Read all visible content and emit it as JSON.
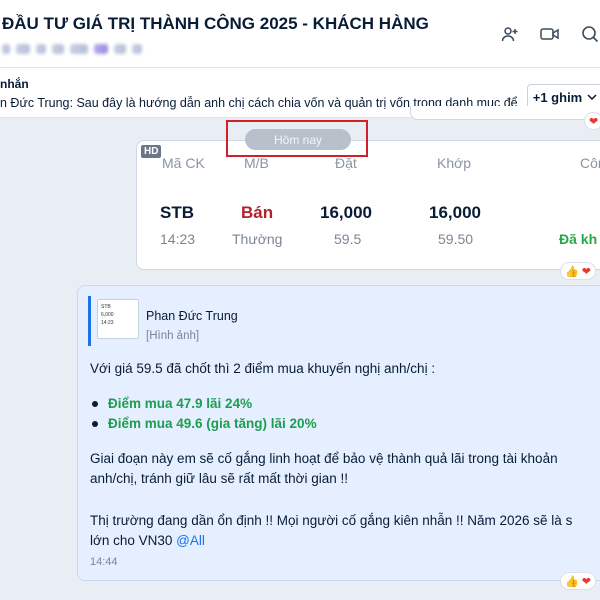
{
  "header": {
    "title": "ĐẦU TƯ GIÁ TRỊ THÀNH CÔNG 2025 - KHÁCH HÀNG",
    "icons": [
      "add-member-icon",
      "video-call-icon",
      "search-icon"
    ]
  },
  "pinned": {
    "label": "nhắn",
    "text": "n Đức Trung: Sau đây là hướng dẫn anh chị cách chia vốn và quản trị vốn trong danh mục để ...",
    "pin_count_label": "+1 ghim"
  },
  "date_divider": {
    "label": "Hôm nay"
  },
  "order_card": {
    "badge": "HD",
    "headers": {
      "symbol": "Mã CK",
      "side": "M/B",
      "ordered": "Đặt",
      "matched": "Khớp",
      "status": "Công"
    },
    "row": {
      "symbol": "STB",
      "time": "14:23",
      "side": "Bán",
      "order_type": "Thường",
      "ordered_qty": "16,000",
      "ordered_price": "59.5",
      "matched_qty": "16,000",
      "matched_price": "59.50",
      "status": "Đã kh"
    }
  },
  "message": {
    "quote": {
      "sender": "Phan Đức Trung",
      "attachment_label": "[Hình ảnh]",
      "thumb_text": [
        "STB",
        "6,000",
        "14:23"
      ]
    },
    "line1": "Với giá 59.5 đã chốt thì 2 điểm mua khuyến nghị anh/chị :",
    "bullets": [
      "Điểm mua 47.9 lãi 24%",
      "Điểm mua 49.6 (gia tăng) lãi 20%"
    ],
    "para2_line1": "Giai đoạn này em sẽ cố gắng linh hoạt để bảo vệ thành quả lãi trong tài khoản",
    "para2_line2": "anh/chị, tránh giữ lâu sẽ rất mất thời gian !!",
    "para3_line1": "Thị trường đang dần ổn định !! Mọi người cố gắng kiên nhẫn !! Năm 2026 sẽ là s",
    "para3_line2_prefix": "lớn cho VN30 ",
    "mention": "@All",
    "time": "14:44"
  }
}
